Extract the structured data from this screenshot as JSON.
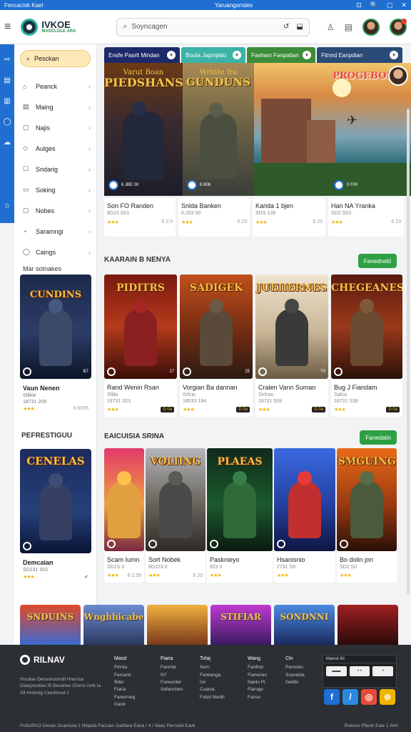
{
  "statusbar": {
    "left": "Fencacisk Kael",
    "center": "Yaruangsmdes",
    "icons": [
      "⊡",
      "🔍",
      "▢",
      "✕"
    ]
  },
  "header": {
    "logo_title": "IVKOE",
    "logo_sub": "MASCLGLE ARA",
    "search_placeholder": "Soyncagen",
    "search_icons": [
      "↺",
      "⬓"
    ]
  },
  "sidebar": {
    "pill": "Pesckan",
    "items": [
      {
        "icon": "⌂",
        "label": "Peanck"
      },
      {
        "icon": "▤",
        "label": "Maing"
      },
      {
        "icon": "▢",
        "label": "Najis"
      },
      {
        "icon": "◇",
        "label": "Aulges"
      },
      {
        "icon": "☐",
        "label": "Sndarig"
      },
      {
        "icon": "▭",
        "label": "Soking"
      },
      {
        "icon": "▢",
        "label": "Nobes"
      },
      {
        "icon": "◔",
        "label": "Saramngi"
      },
      {
        "icon": "◯",
        "label": "Caings"
      }
    ],
    "settings_label": "Mar sotnakes",
    "card1": {
      "art_title": "CUNDINS",
      "t1": "Vaun Nenen",
      "t2": "Sfilkie",
      "t3": "18731 209",
      "count": "6 6005",
      "badge": "B7"
    },
    "section2_title": "PEFRESTIGUU",
    "card2": {
      "art_title": "CENELAS",
      "t1": "Demcaian",
      "t2": "SD231 S01",
      "t3": ""
    }
  },
  "tabs": [
    {
      "label": "Ensfe Pasrlt Mindan",
      "color": "#1c2a6a"
    },
    {
      "label": "Bouta Japmjiato",
      "color": "#3bb3a6"
    },
    {
      "label": "Fasham Fanpatian",
      "color": "#3e8b3a"
    },
    {
      "label": "Fitnnd Eanpdian",
      "color": "#2a4a78"
    }
  ],
  "hero": [
    {
      "title": "PIEDSHANS",
      "top": "Varut Boan",
      "badge": "6 JBE 00"
    },
    {
      "title": "GUNDUNS",
      "top": "Wrtnte fro",
      "badge": "6 806"
    },
    {
      "title": "",
      "top": "",
      "badge": ""
    },
    {
      "title": "PROGEBOIE",
      "top": "",
      "badge": "0 F00"
    }
  ],
  "hero_caps": [
    {
      "t1": "Son FO Randen",
      "t2": "8D23 S01",
      "rating": "6 2.0"
    },
    {
      "t1": "Snlda Banken",
      "t2": "6.203 00",
      "rating": "6 23"
    },
    {
      "t1": "Karida 1 bjen",
      "t2": "SDS 139",
      "rating": "6 23"
    },
    {
      "t1": "Han NA Yranka",
      "t2": "SD2 S03",
      "rating": "6 23"
    }
  ],
  "section1": {
    "title": "KAARAIN B NENYA",
    "button": "Fanednatd",
    "cards": [
      {
        "art_title": "PIDITRS",
        "t1": "Rand Wenin Rsan",
        "t2": "Sfilla",
        "t3": "18731 S01",
        "tag": "D 0a",
        "badge": "17"
      },
      {
        "art_title": "SADIGEK",
        "t1": "Vorgian Ba dannan",
        "t2": "Srfcio",
        "t3": "18533 194",
        "tag": "D 0a",
        "badge": "25"
      },
      {
        "art_title": "JUEIIERNES",
        "t1": "Cralen Vann Suman",
        "t2": "Sirlcas",
        "t3": "18731 539",
        "tag": "D 0a",
        "badge": "T0"
      },
      {
        "art_title": "CHEGEANES",
        "t1": "Bug J Fiandam",
        "t2": "Safca",
        "t3": "18731 S39",
        "tag": "D 0a",
        "badge": ""
      }
    ]
  },
  "section2": {
    "title": "EAICUISIA SRINA",
    "button": "Fanedatin",
    "cards": [
      {
        "art_title": "",
        "t1": "Scam Iumn",
        "t2": "SD2S 0",
        "t3": "",
        "rating": "6 2.59"
      },
      {
        "art_title": "VOLIING",
        "t1": "Sort Nobek",
        "t2": "8D223 0",
        "t3": "",
        "rating": "6 20"
      },
      {
        "art_title": "PLAEAS",
        "t1": "Pasknieyo",
        "t2": "823 0",
        "t3": "",
        "rating": ""
      },
      {
        "art_title": "",
        "t1": "Hsanisnio",
        "t2": "2731 S9",
        "t3": "",
        "rating": ""
      },
      {
        "art_title": "SMGUING",
        "t1": "Bo dolin jon",
        "t2": "SD2 S0",
        "t3": "",
        "rating": ""
      }
    ]
  },
  "strip": [
    "SNDUINS",
    "Wnghhicabe",
    "",
    "STIFIAR",
    "SONDNNI",
    ""
  ],
  "footer": {
    "logo": "RILNAV",
    "desc": "Hrodias Densonoondil Hrarrisa Dearprestlas Ifl Decarien Clorris Isrik Ia Sit Hrdonig Clardhosd 1",
    "cols": [
      {
        "h": "Masd",
        "items": [
          "Pinnia",
          "Fercanir",
          "Bdei",
          "Fiaria",
          "Fanernieg",
          "Ganil"
        ]
      },
      {
        "h": "Fiaria",
        "items": [
          "Fanrnie",
          "N7",
          "",
          "Fanesnter",
          "Sefanchen"
        ]
      },
      {
        "h": "Tirlaj",
        "items": [
          "Sern",
          "Fanbanga",
          "Uo",
          "Cuania",
          "Falsd Niedh"
        ]
      },
      {
        "h": "Wang",
        "items": [
          "Fanfind",
          "Fianerian",
          "Nanlo Pl",
          "Flaroge",
          "Fanso"
        ]
      },
      {
        "h": "Cln",
        "items": [
          "Pannsiin",
          "Ssandsia",
          "Geldis"
        ]
      }
    ],
    "box_title": "Mamsl Ihl",
    "box_buttons": [
      "▬▬",
      "• •",
      "•"
    ],
    "social": [
      "f",
      "/",
      "◎",
      "⊜"
    ],
    "bottom_left": "Pcifo/PAO    Gesan     Ocarisvia 1 Nfapda Facsain Gahfara Eana / 4 / Saey Percotid Eavk",
    "bottom_right": "Rskeos Pfienk Eaie   1 AVA"
  }
}
